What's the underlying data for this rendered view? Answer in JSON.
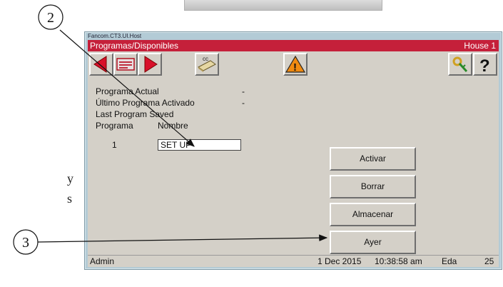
{
  "callouts": [
    "2",
    "3"
  ],
  "side_text": [
    "y",
    "s"
  ],
  "window": {
    "title": "Fancom.CT3.UI.Host",
    "header_title": "Programas/Disponibles",
    "house": "House 1"
  },
  "toolbar": {
    "icons": [
      "arrow-left-icon",
      "list-icon",
      "arrow-right-icon",
      "cc-icon",
      "warning-icon",
      "key-icon",
      "help-icon"
    ],
    "cc_label": "cc",
    "help_label": "?",
    "warning_label": "!"
  },
  "info": {
    "actual_label": "Programa Actual",
    "actual_value": "-",
    "ultimo_label": "Último Programa Activado",
    "ultimo_value": "-",
    "saved_label": "Last Program Saved",
    "col_programa": "Programa",
    "col_nombre": "Nombre",
    "row_number": "1",
    "row_name": "SET UP"
  },
  "buttons": {
    "activar": "Activar",
    "borrar": "Borrar",
    "almacenar": "Almacenar",
    "ayer": "Ayer"
  },
  "status": {
    "user": "Admin",
    "date": "1 Dec 2015",
    "time": "10:38:58 am",
    "name": "Eda",
    "number": "25"
  },
  "colors": {
    "header_red": "#c5203a",
    "panel_gray": "#d4d0c8",
    "window_frame": "#b3cbd6"
  }
}
